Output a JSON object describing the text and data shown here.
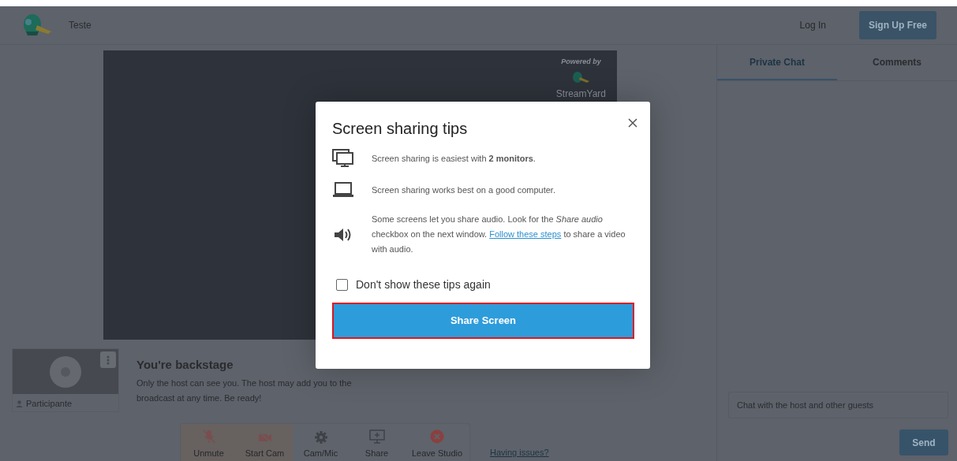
{
  "header": {
    "app_name": "Teste",
    "login": "Log In",
    "signup": "Sign Up Free"
  },
  "video": {
    "powered_by": "Powered by",
    "brand": "StreamYard"
  },
  "participant": {
    "name": "Participante"
  },
  "backstage": {
    "title": "You're backstage",
    "message": "Only the host can see you. The host may add you to the broadcast at any time. Be ready!"
  },
  "toolbar": [
    {
      "kind": "mic-off",
      "label": "Unmute"
    },
    {
      "kind": "cam-off",
      "label": "Start Cam"
    },
    {
      "kind": "settings",
      "label": "Cam/Mic"
    },
    {
      "kind": "share",
      "label": "Share"
    },
    {
      "kind": "leave",
      "label": "Leave Studio"
    }
  ],
  "help_link": "Having issues?",
  "chat": {
    "tabs": [
      {
        "label": "Private Chat",
        "selected": true
      },
      {
        "label": "Comments",
        "selected": false
      }
    ],
    "placeholder": "Chat with the host and other guests",
    "send": "Send"
  },
  "modal": {
    "title": "Screen sharing tips",
    "tips": [
      {
        "kind": "monitors",
        "text": "Screen sharing is easiest with **2 monitors**."
      },
      {
        "kind": "laptop",
        "text": "Screen sharing works best on a good computer."
      },
      {
        "kind": "audio",
        "text": "Some screens let you share audio. Look for the *Share audio* checkbox on the next window.",
        "link": "Follow these steps",
        "text_after": "to share a video with audio."
      }
    ],
    "checkbox": {
      "label": "Don't show these tips again",
      "checked": false
    },
    "button": "Share Screen"
  }
}
